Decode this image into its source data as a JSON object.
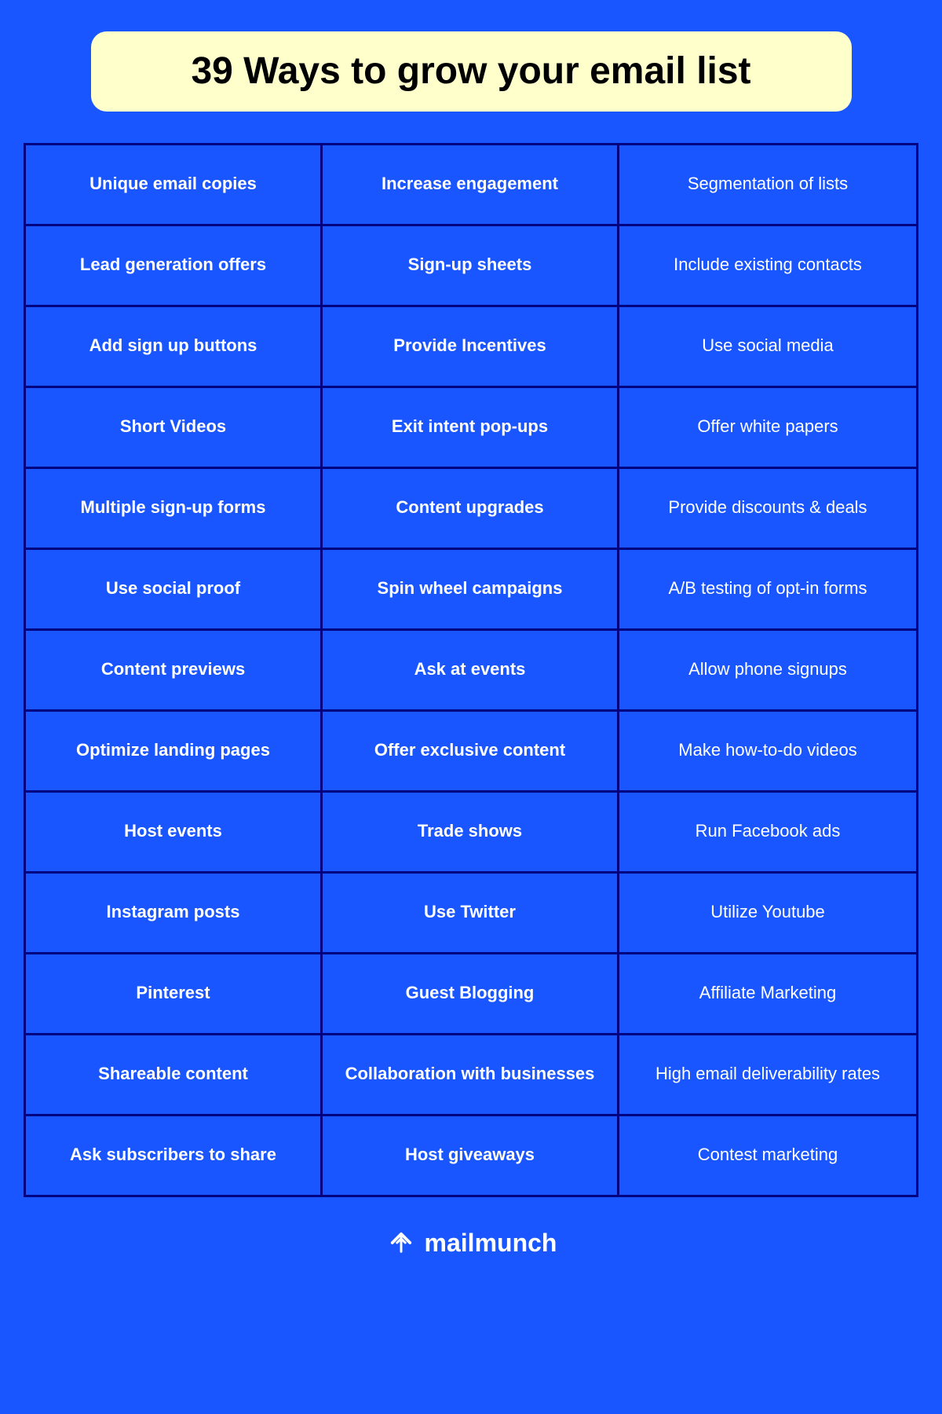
{
  "title": "39 Ways to grow your email list",
  "rows": [
    [
      {
        "text": "Unique email copies",
        "bold": true
      },
      {
        "text": "Increase engagement",
        "bold": true
      },
      {
        "text": "Segmentation of lists",
        "bold": false
      }
    ],
    [
      {
        "text": "Lead generation offers",
        "bold": true
      },
      {
        "text": "Sign-up sheets",
        "bold": true
      },
      {
        "text": "Include existing contacts",
        "bold": false
      }
    ],
    [
      {
        "text": "Add sign up buttons",
        "bold": true
      },
      {
        "text": "Provide Incentives",
        "bold": true
      },
      {
        "text": "Use social media",
        "bold": false
      }
    ],
    [
      {
        "text": "Short Videos",
        "bold": true
      },
      {
        "text": "Exit intent pop-ups",
        "bold": true
      },
      {
        "text": "Offer white papers",
        "bold": false
      }
    ],
    [
      {
        "text": "Multiple sign-up forms",
        "bold": true
      },
      {
        "text": "Content upgrades",
        "bold": true
      },
      {
        "text": "Provide discounts & deals",
        "bold": false
      }
    ],
    [
      {
        "text": "Use social proof",
        "bold": true
      },
      {
        "text": "Spin wheel campaigns",
        "bold": true
      },
      {
        "text": "A/B testing of opt-in forms",
        "bold": false
      }
    ],
    [
      {
        "text": "Content previews",
        "bold": true
      },
      {
        "text": "Ask at events",
        "bold": true
      },
      {
        "text": "Allow phone signups",
        "bold": false
      }
    ],
    [
      {
        "text": "Optimize landing pages",
        "bold": true
      },
      {
        "text": "Offer exclusive content",
        "bold": true
      },
      {
        "text": "Make how-to-do videos",
        "bold": false
      }
    ],
    [
      {
        "text": "Host events",
        "bold": true
      },
      {
        "text": "Trade shows",
        "bold": true
      },
      {
        "text": "Run Facebook ads",
        "bold": false
      }
    ],
    [
      {
        "text": "Instagram posts",
        "bold": true
      },
      {
        "text": "Use Twitter",
        "bold": true
      },
      {
        "text": "Utilize Youtube",
        "bold": false
      }
    ],
    [
      {
        "text": "Pinterest",
        "bold": true
      },
      {
        "text": "Guest Blogging",
        "bold": true
      },
      {
        "text": "Affiliate Marketing",
        "bold": false
      }
    ],
    [
      {
        "text": "Shareable content",
        "bold": true
      },
      {
        "text": "Collaboration with businesses",
        "bold": true
      },
      {
        "text": "High email deliverability rates",
        "bold": false
      }
    ],
    [
      {
        "text": "Ask subscribers to share",
        "bold": true
      },
      {
        "text": "Host giveaways",
        "bold": true
      },
      {
        "text": "Contest marketing",
        "bold": false
      }
    ]
  ],
  "footer": {
    "brand": "mailmunch"
  }
}
